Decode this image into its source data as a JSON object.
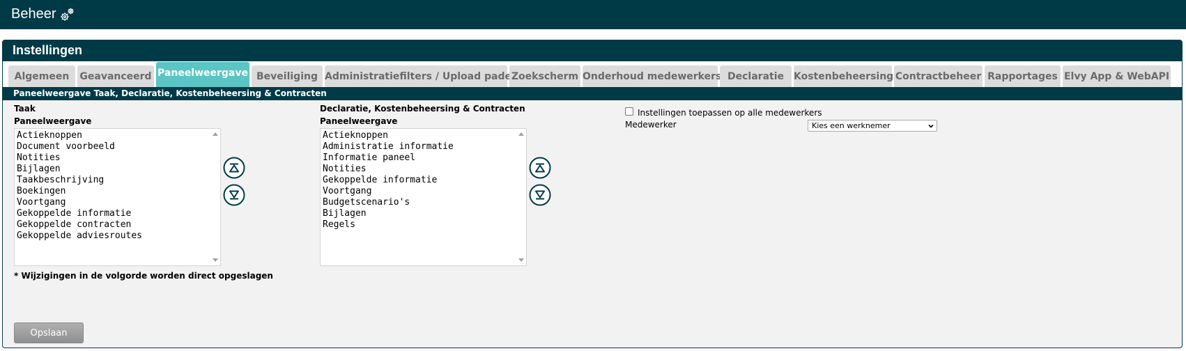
{
  "header": {
    "title": "Beheer",
    "icon": "gears-icon"
  },
  "panel": {
    "title": "Instellingen"
  },
  "tabs": [
    {
      "label": "Algemeen",
      "active": false
    },
    {
      "label": "Geavanceerd",
      "active": false
    },
    {
      "label": "Paneelweergave",
      "active": true
    },
    {
      "label": "Beveiliging",
      "active": false
    },
    {
      "label": "Administratiefilters / Upload paden",
      "active": false
    },
    {
      "label": "Zoekscherm",
      "active": false
    },
    {
      "label": "Onderhoud medewerkers",
      "active": false
    },
    {
      "label": "Declaratie",
      "active": false
    },
    {
      "label": "Kostenbeheersing",
      "active": false
    },
    {
      "label": "Contractbeheer",
      "active": false
    },
    {
      "label": "Rapportages",
      "active": false
    },
    {
      "label": "Elvy App & WebAPI",
      "active": false
    }
  ],
  "section_title": "Paneelweergave Taak, Declaratie, Kostenbeheersing & Contracten",
  "left": {
    "group_label": "Taak",
    "list_label": "Paneelweergave",
    "items": [
      "Actieknoppen",
      "Document voorbeeld",
      "Notities",
      "Bijlagen",
      "Taakbeschrijving",
      "Boekingen",
      "Voortgang",
      "Gekoppelde informatie",
      "Gekoppelde contracten",
      "Gekoppelde adviesroutes"
    ]
  },
  "right": {
    "group_label": "Declaratie, Kostenbeheersing & Contracten",
    "list_label": "Paneelweergave",
    "items": [
      "Actieknoppen",
      "Administratie informatie",
      "Informatie paneel",
      "Notities",
      "Gekoppelde informatie",
      "Voortgang",
      "Budgetscenario's",
      "Bijlagen",
      "Regels"
    ]
  },
  "settings": {
    "apply_all_label": "Instellingen toepassen op alle medewerkers",
    "apply_all_checked": false,
    "employee_label": "Medewerker",
    "employee_select_value": "Kies een werknemer"
  },
  "note": "*  Wijzigingen in de volgorde worden direct opgeslagen",
  "save_label": "Opslaan",
  "colors": {
    "dark": "#013a47",
    "active_tab": "#5bc4c4",
    "tab": "#dcdcdc"
  }
}
